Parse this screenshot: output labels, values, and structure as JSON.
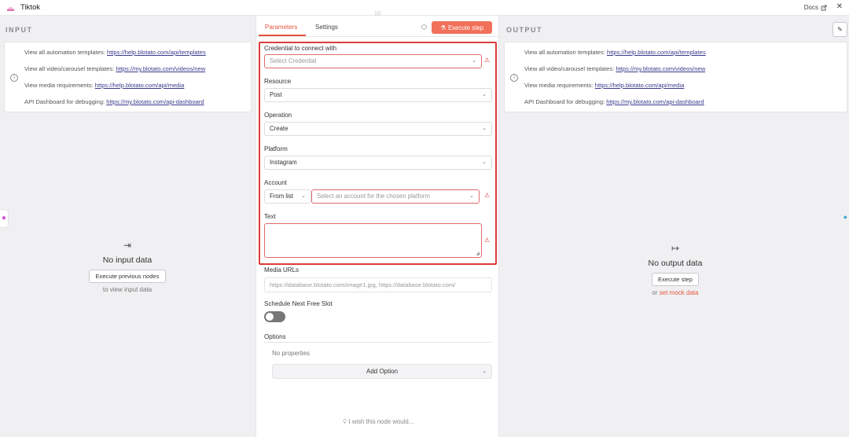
{
  "titlebar": {
    "title": "Tiktok",
    "docs_label": "Docs"
  },
  "input": {
    "label": "INPUT",
    "lines": [
      {
        "text": "View all automation templates: ",
        "link": "https://help.blotato.com/api/templates"
      },
      {
        "text": "View all video/carousel templates: ",
        "link": "https://my.blotato.com/videos/new"
      },
      {
        "text": "View media requirements: ",
        "link": "https://help.blotato.com/api/media"
      },
      {
        "text": "API Dashboard for debugging: ",
        "link": "https://my.blotato.com/api-dashboard"
      }
    ],
    "empty_title": "No input data",
    "button": "Execute previous nodes",
    "sub": "to view input data"
  },
  "output": {
    "label": "OUTPUT",
    "lines": [
      {
        "text": "View all automation templates: ",
        "link": "https://help.blotato.com/api/templates"
      },
      {
        "text": "View all video/carousel templates: ",
        "link": "https://my.blotato.com/videos/new"
      },
      {
        "text": "View media requirements: ",
        "link": "https://help.blotato.com/api/media"
      },
      {
        "text": "API Dashboard for debugging: ",
        "link": "https://my.blotato.com/api-dashboard"
      }
    ],
    "empty_title": "No output data",
    "button": "Execute step",
    "sub_prefix": "or ",
    "sub_link": "set mock data"
  },
  "center": {
    "tabs": [
      "Parameters",
      "Settings"
    ],
    "execute_label": "Execute step",
    "credential": {
      "label": "Credential to connect with",
      "placeholder": "Select Credential"
    },
    "resource": {
      "label": "Resource",
      "value": "Post"
    },
    "operation": {
      "label": "Operation",
      "value": "Create"
    },
    "platform": {
      "label": "Platform",
      "value": "Instagram"
    },
    "account": {
      "label": "Account",
      "mode": "From list",
      "placeholder": "Select an account for the chosen platform"
    },
    "text": {
      "label": "Text"
    },
    "media": {
      "label": "Media URLs",
      "placeholder": "https://database.blotato.com/image1.jpg, https://database.blotato.com/"
    },
    "schedule": {
      "label": "Schedule Next Free Slot"
    },
    "options": {
      "label": "Options",
      "empty": "No properties",
      "add": "Add Option"
    },
    "wish": "I wish this node would..."
  },
  "colors": {
    "accent": "#f0705a",
    "error": "#dc3c3c",
    "link": "#3b3b8e"
  }
}
